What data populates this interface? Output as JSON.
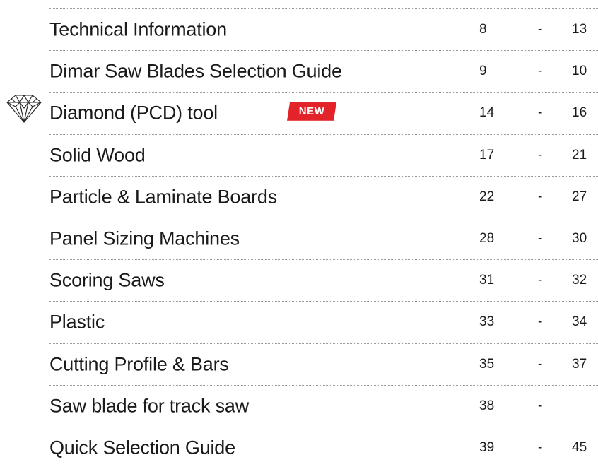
{
  "toc": {
    "badge_label": "NEW",
    "badge_color": "#e3232a",
    "diamond_icon": "diamond-icon",
    "rows": [
      {
        "title": "Technical Information",
        "start": "8",
        "dash": "-",
        "end": "13"
      },
      {
        "title": "Dimar Saw Blades Selection Guide",
        "start": "9",
        "dash": "-",
        "end": "10"
      },
      {
        "title": "Diamond (PCD) tool",
        "start": "14",
        "dash": "-",
        "end": "16"
      },
      {
        "title": "Solid Wood",
        "start": "17",
        "dash": "-",
        "end": "21"
      },
      {
        "title": "Particle & Laminate Boards",
        "start": "22",
        "dash": "-",
        "end": "27"
      },
      {
        "title": "Panel Sizing Machines",
        "start": "28",
        "dash": "-",
        "end": "30"
      },
      {
        "title": "Scoring Saws",
        "start": "31",
        "dash": "-",
        "end": "32"
      },
      {
        "title": "Plastic",
        "start": "33",
        "dash": "-",
        "end": "34"
      },
      {
        "title": "Cutting Profile & Bars",
        "start": "35",
        "dash": "-",
        "end": "37"
      },
      {
        "title": "Saw blade for track saw",
        "start": "38",
        "dash": "-",
        "end": ""
      },
      {
        "title": "Quick Selection Guide",
        "start": "39",
        "dash": "-",
        "end": "45"
      }
    ]
  }
}
